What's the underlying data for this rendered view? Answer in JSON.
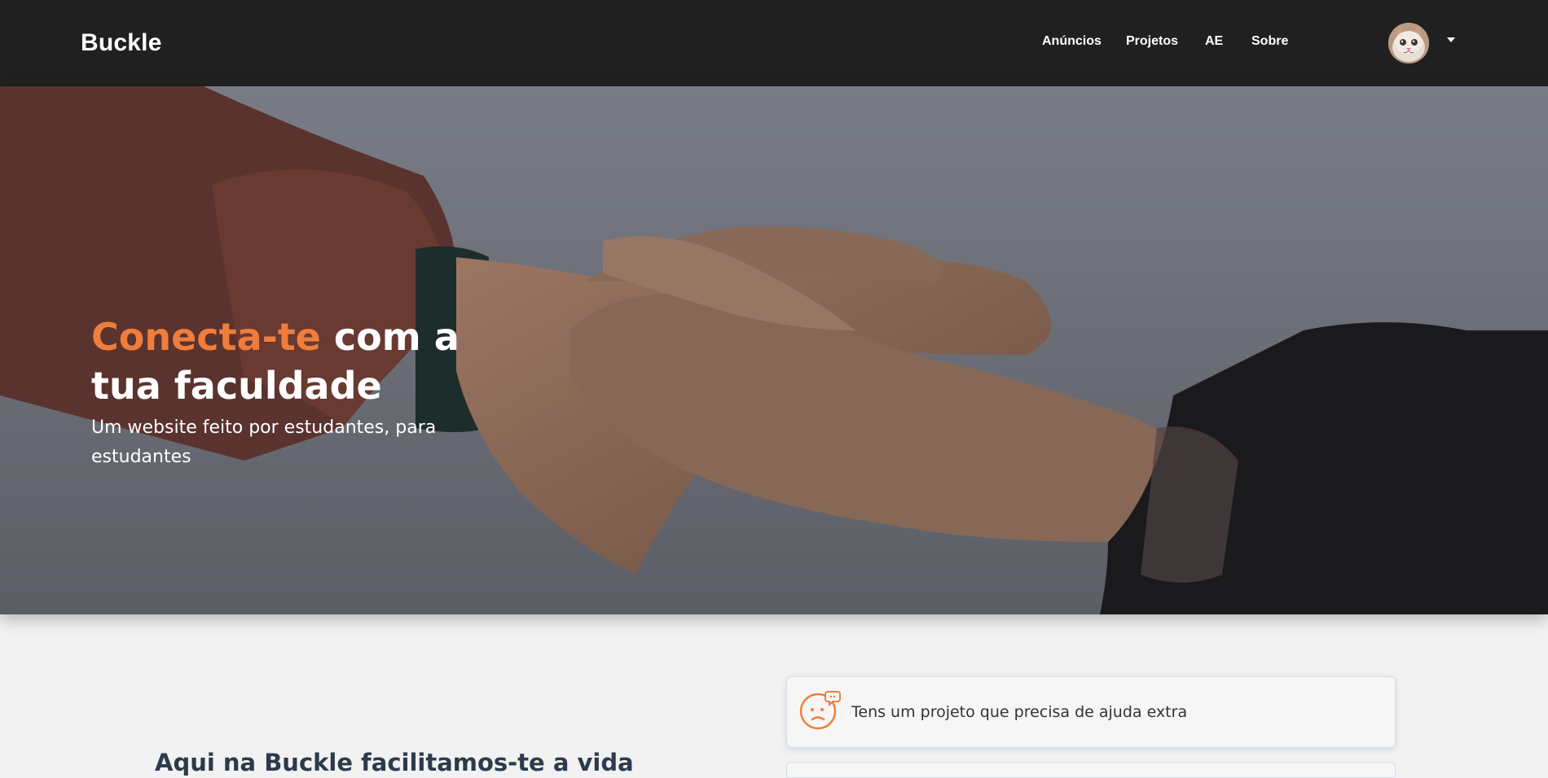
{
  "navbar": {
    "brand": "Buckle",
    "links": [
      "Anúncios",
      "Projetos",
      "AE",
      "Sobre"
    ],
    "avatar_icon": "cat-avatar-icon",
    "dropdown_icon": "caret-down-icon"
  },
  "hero": {
    "title_accent": "Conecta-te",
    "title_rest": " com a tua faculdade",
    "subtitle": "Um website feito por estudantes, para estudantes",
    "accent_color": "#f07d3c"
  },
  "main": {
    "heading": "Aqui na Buckle facilitamos-te a vida",
    "cards": [
      {
        "icon": "confused-face-speech-icon",
        "text": "Tens um projeto que precisa de ajuda extra"
      }
    ]
  }
}
